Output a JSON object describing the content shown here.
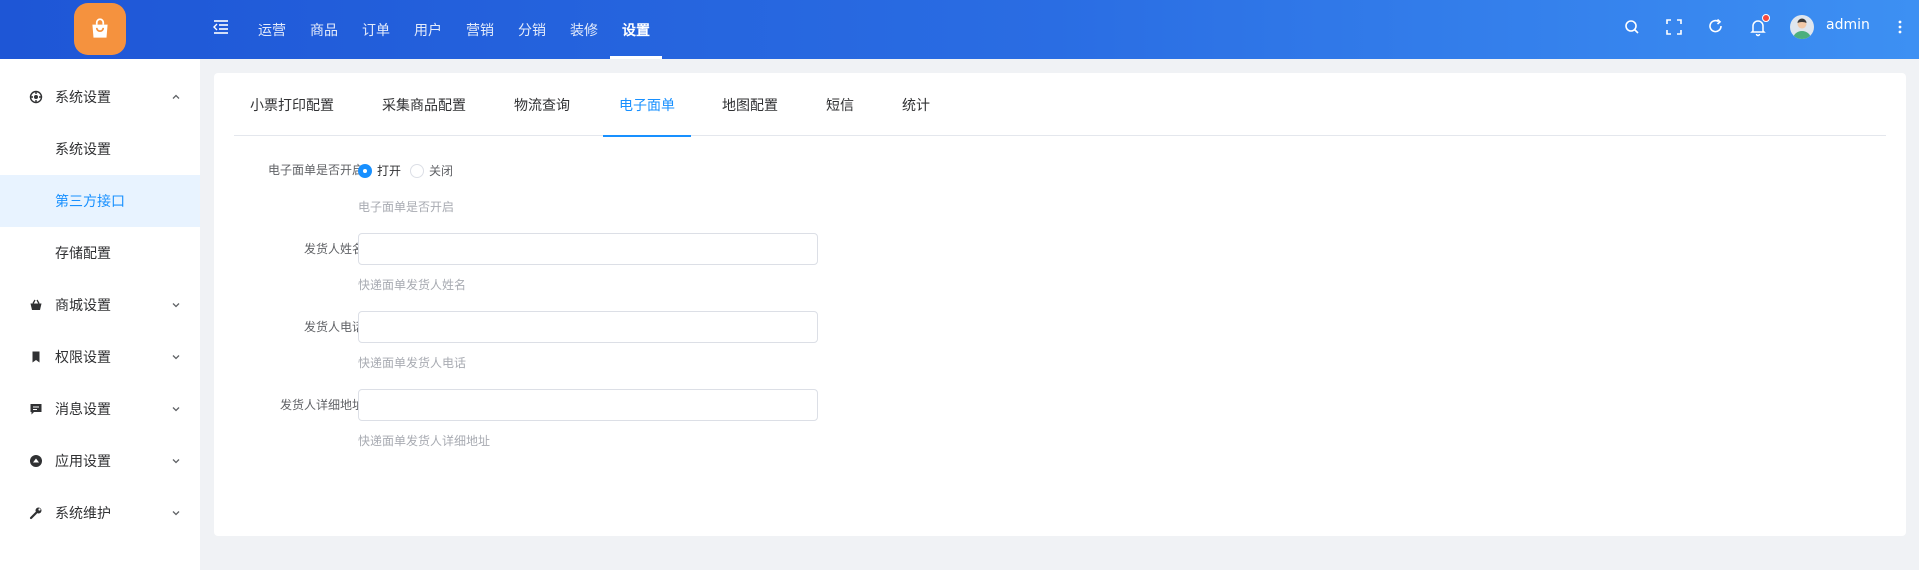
{
  "header": {
    "logo_icon": "shopping-bag-icon",
    "nav": [
      "运营",
      "商品",
      "订单",
      "用户",
      "营销",
      "分销",
      "装修",
      "设置"
    ],
    "active_nav": "设置",
    "username": "admin",
    "brand_color": "#2a6de3",
    "logo_color": "#f5923e"
  },
  "sidebar": {
    "groups": [
      {
        "label": "系统设置",
        "icon": "settings-icon",
        "expanded": true,
        "children": [
          "系统设置",
          "第三方接口",
          "存储配置"
        ],
        "active_child": "第三方接口"
      },
      {
        "label": "商城设置",
        "icon": "basket-icon"
      },
      {
        "label": "权限设置",
        "icon": "bookmark-icon"
      },
      {
        "label": "消息设置",
        "icon": "message-icon"
      },
      {
        "label": "应用设置",
        "icon": "app-icon"
      },
      {
        "label": "系统维护",
        "icon": "wrench-icon"
      }
    ]
  },
  "tabs": [
    "小票打印配置",
    "采集商品配置",
    "物流查询",
    "电子面单",
    "地图配置",
    "短信",
    "统计"
  ],
  "active_tab": "电子面单",
  "form": {
    "enable": {
      "label": "电子面单是否开启",
      "options": [
        "打开",
        "关闭"
      ],
      "selected": "打开",
      "hint": "电子面单是否开启"
    },
    "sender_name": {
      "label": "发货人姓名",
      "value": "",
      "hint": "快递面单发货人姓名"
    },
    "sender_phone": {
      "label": "发货人电话",
      "value": "",
      "hint": "快递面单发货人电话"
    },
    "sender_address": {
      "label": "发货人详细地址",
      "value": "",
      "hint": "快递面单发货人详细地址"
    }
  },
  "accent_color": "#1890ff",
  "notification_badge_color": "#f5483b"
}
